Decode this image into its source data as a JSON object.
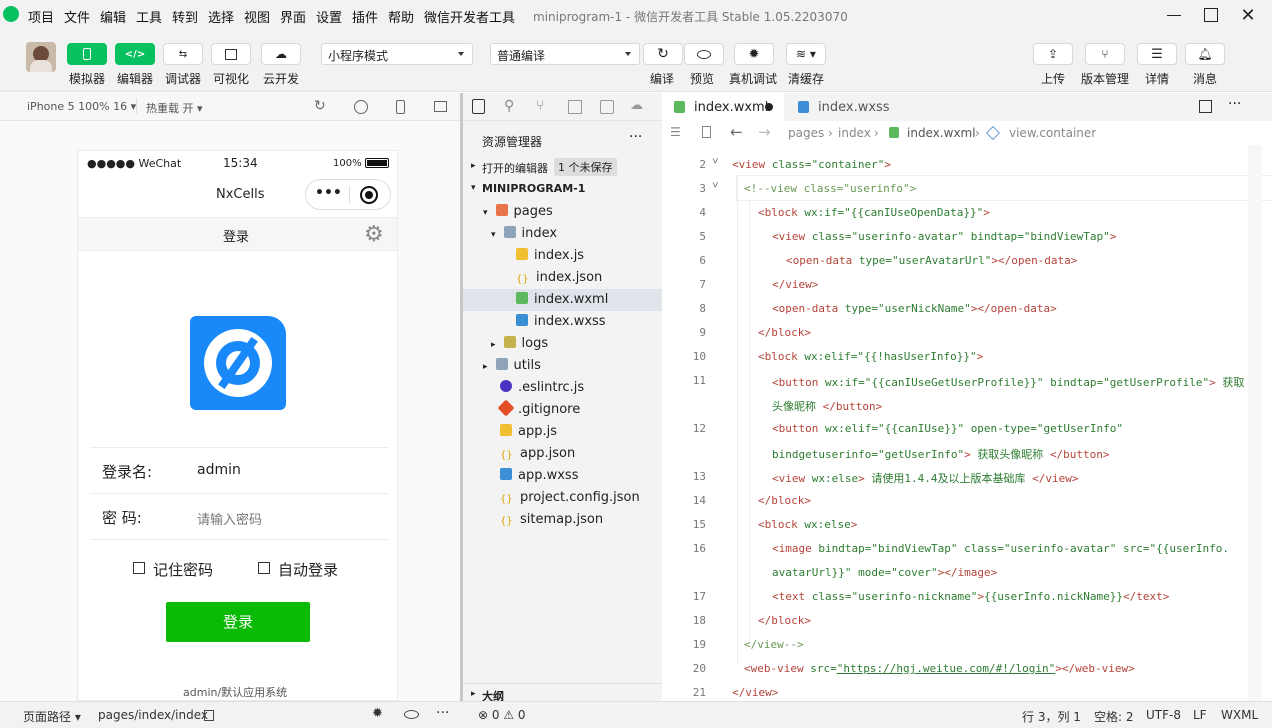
{
  "menu": [
    "项目",
    "文件",
    "编辑",
    "工具",
    "转到",
    "选择",
    "视图",
    "界面",
    "设置",
    "插件",
    "帮助",
    "微信开发者工具"
  ],
  "window_title": "miniprogram-1 - 微信开发者工具 Stable 1.05.2203070",
  "toolbar": {
    "buttons": [
      "模拟器",
      "编辑器",
      "调试器",
      "可视化",
      "云开发"
    ],
    "mode_select": "小程序模式",
    "compile_select": "普通编译",
    "actions": [
      "编译",
      "预览",
      "真机调试",
      "清缓存"
    ],
    "right": [
      "上传",
      "版本管理",
      "详情",
      "消息"
    ]
  },
  "simulator": {
    "device": "iPhone 5 100% 16",
    "hot_reload": "热重载 开",
    "status_left": "●●●●● WeChat",
    "status_time": "15:34",
    "status_battery": "100%",
    "nav_title": "NxCells",
    "page_header": "登录",
    "username_label": "登录名:",
    "username_value": "admin",
    "password_label": "密 码:",
    "password_placeholder": "请输入密码",
    "remember": "记住密码",
    "auto_login": "自动登录",
    "login_button": "登录",
    "footer": "admin/默认应用系统"
  },
  "explorer": {
    "title": "资源管理器",
    "open_editors": "打开的编辑器",
    "unsaved_badge": "1 个未保存",
    "project": "MINIPROGRAM-1",
    "items": [
      "pages",
      "index",
      "index.js",
      "index.json",
      "index.wxml",
      "index.wxss",
      "logs",
      "utils",
      ".eslintrc.js",
      ".gitignore",
      "app.js",
      "app.json",
      "app.wxss",
      "project.config.json",
      "sitemap.json"
    ],
    "outline": "大纲"
  },
  "editor": {
    "tabs": [
      "index.wxml",
      "index.wxss"
    ],
    "breadcrumb": [
      "pages",
      "index",
      "index.wxml",
      "view.container"
    ],
    "line_numbers": [
      "2",
      "3",
      "4",
      "5",
      "6",
      "7",
      "8",
      "9",
      "10",
      "11",
      "",
      "12",
      "",
      "13",
      "14",
      "15",
      "16",
      "",
      "17",
      "18",
      "19",
      "20",
      "21"
    ]
  },
  "status": {
    "path_label": "页面路径",
    "path_value": "pages/index/index",
    "errors": "0",
    "warnings": "0",
    "cursor": "行 3，列 1",
    "spaces": "空格: 2",
    "encoding": "UTF-8",
    "eol": "LF",
    "lang": "WXML"
  },
  "colors": {
    "accent_green": "#07c160",
    "login_green": "#09bb07",
    "logo_blue": "#1989fa"
  }
}
